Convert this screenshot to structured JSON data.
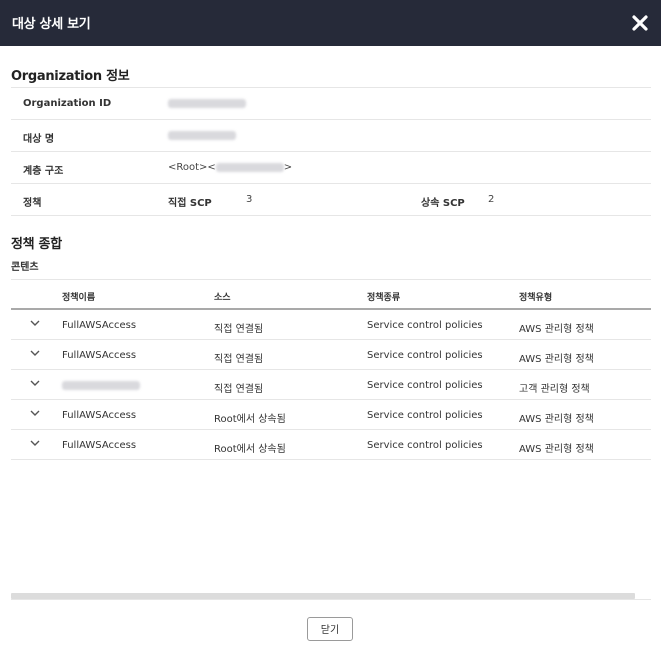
{
  "header": {
    "title": "대상 상세 보기",
    "close_icon": "close-icon"
  },
  "org_section": {
    "title": "Organization 정보"
  },
  "info": {
    "org_id_label": "Organization ID",
    "target_name_label": "대상 명",
    "hierarchy_label": "계층 구조",
    "hierarchy_prefix": "<Root><",
    "hierarchy_suffix": ">",
    "policy_label": "정책",
    "direct_scp_label": "직접 SCP",
    "direct_scp_value": "3",
    "inherited_scp_label": "상속 SCP",
    "inherited_scp_value": "2"
  },
  "policy_section": {
    "title": "정책 종합",
    "subheading": "콘텐츠"
  },
  "policy_table": {
    "columns": [
      "정책이름",
      "소스",
      "정책종류",
      "정책유형"
    ],
    "rows": [
      {
        "name": "FullAWSAccess",
        "source": "직접 연결됨",
        "kind": "Service control policies",
        "type": "AWS 관리형 정책",
        "blurred": false
      },
      {
        "name": "FullAWSAccess",
        "source": "직접 연결됨",
        "kind": "Service control policies",
        "type": "AWS 관리형 정책",
        "blurred": false
      },
      {
        "name": "",
        "source": "직접 연결됨",
        "kind": "Service control policies",
        "type": "고객 관리형 정책",
        "blurred": true
      },
      {
        "name": "FullAWSAccess",
        "source": "Root에서 상속됨",
        "kind": "Service control policies",
        "type": "AWS 관리형 정책",
        "blurred": false
      },
      {
        "name": "FullAWSAccess",
        "source": "Root에서 상속됨",
        "kind": "Service control policies",
        "type": "AWS 관리형 정책",
        "blurred": false
      }
    ]
  },
  "footer": {
    "close_label": "닫기"
  }
}
